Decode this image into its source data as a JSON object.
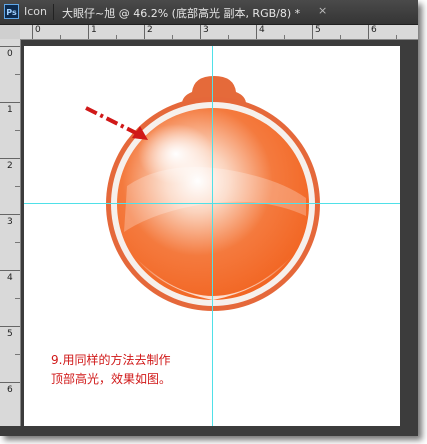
{
  "window": {
    "app_icon": "Ps",
    "tab_inactive": "Icon",
    "tab_active_title": "大眼仔~旭 @ 46.2% (底部高光 副本, RGB/8) *",
    "close_glyph": "×"
  },
  "ruler": {
    "top_numbers": [
      "0",
      "1",
      "2",
      "3",
      "4",
      "5",
      "6"
    ],
    "left_numbers": [
      "0",
      "1",
      "2",
      "3",
      "4",
      "5",
      "6"
    ]
  },
  "canvas": {
    "caption_line1": "9.用同样的方法去制作",
    "caption_line2": "顶部高光，效果如图。"
  },
  "colors": {
    "orb_orange": "#f26522",
    "orb_border": "#e5683a",
    "guide": "#4fe0e8",
    "arrow": "#d01818"
  }
}
